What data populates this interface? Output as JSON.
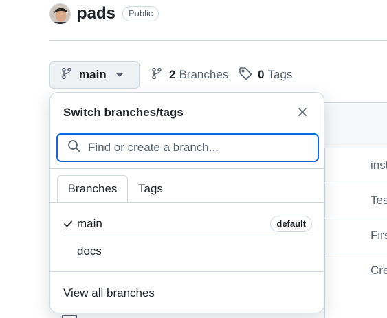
{
  "repo": {
    "name": "pads",
    "visibility": "Public"
  },
  "branch_button": {
    "label": "main"
  },
  "branches_link": {
    "count": "2",
    "label": "Branches"
  },
  "tags_link": {
    "count": "0",
    "label": "Tags"
  },
  "background_rows": [
    "inst",
    "Tes",
    "Firs",
    "Cre"
  ],
  "popover": {
    "title": "Switch branches/tags",
    "search_placeholder": "Find or create a branch...",
    "search_value": "",
    "tabs": [
      {
        "label": "Branches",
        "selected": true
      },
      {
        "label": "Tags",
        "selected": false
      }
    ],
    "branches": [
      {
        "name": "main",
        "checked": true,
        "badge": "default"
      },
      {
        "name": "docs",
        "checked": false,
        "badge": ""
      }
    ],
    "footer_link": "View all branches"
  },
  "colors": {
    "accent": "#0969da",
    "border": "#d1d9e0",
    "muted_text": "#59636e",
    "text": "#1f2328",
    "button_bg": "#eff2f5"
  }
}
